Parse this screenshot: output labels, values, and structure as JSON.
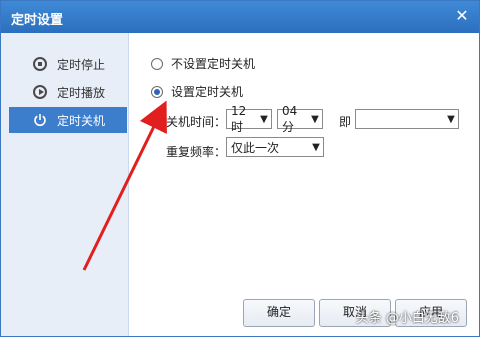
{
  "window": {
    "title": "定时设置",
    "close_icon": "close-icon"
  },
  "sidebar": {
    "items": [
      {
        "label": "定时停止",
        "icon": "stop-icon"
      },
      {
        "label": "定时播放",
        "icon": "play-icon"
      },
      {
        "label": "定时关机",
        "icon": "power-icon"
      }
    ],
    "active_index": 2
  },
  "content": {
    "option_none": "不设置定时关机",
    "option_set": "设置定时关机",
    "shutdown_time_label": "关机时间：",
    "hour": "12时",
    "minute": "04分",
    "immediate_label": "即",
    "immediate_value": "",
    "repeat_label": "重复频率：",
    "repeat_value": "仅此一次"
  },
  "buttons": {
    "ok": "确定",
    "cancel": "取消",
    "apply": "应用"
  },
  "watermark": "头条 @小白无敌6",
  "colors": {
    "accent": "#3c7dcc",
    "arrow": "#e21f1f"
  }
}
